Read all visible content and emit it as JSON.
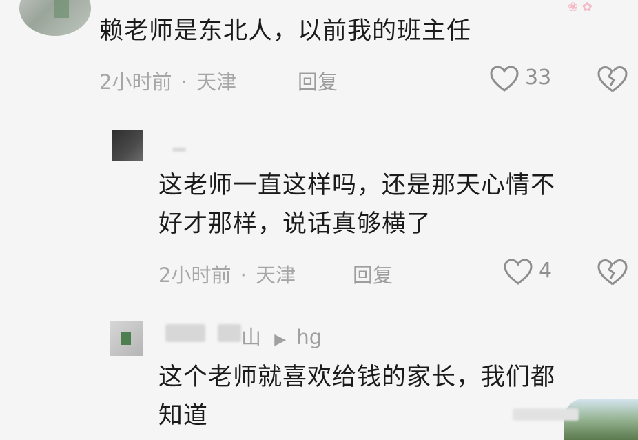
{
  "comment": {
    "text": "赖老师是东北人，以前我的班主任",
    "time": "2小时前",
    "location": "天津",
    "reply_label": "回复",
    "likes": "33"
  },
  "reply1": {
    "line1": "这老师一直这样吗，还是那天心情不",
    "line2": "好才那样，说话真够横了",
    "time": "2小时前",
    "location": "天津",
    "reply_label": "回复",
    "likes": "4"
  },
  "reply2": {
    "name_visible": "山",
    "reply_to": "hg",
    "line1": "这个老师就喜欢给钱的家长，我们都",
    "line2": "知道"
  },
  "separator": "·",
  "colors": {
    "background": "#f5f5f5",
    "text": "#1b1b1b",
    "meta": "#a6a6a6"
  }
}
